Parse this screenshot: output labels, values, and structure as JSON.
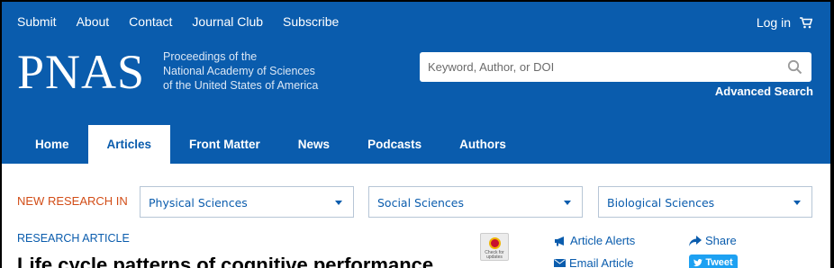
{
  "utility_nav": [
    "Submit",
    "About",
    "Contact",
    "Journal Club",
    "Subscribe"
  ],
  "login_label": "Log in",
  "logo_text": "PNAS",
  "tagline": [
    "Proceedings of the",
    "National Academy of Sciences",
    "of the United States of America"
  ],
  "search": {
    "placeholder": "Keyword, Author, or DOI",
    "advanced": "Advanced Search"
  },
  "main_tabs": [
    {
      "label": "Home",
      "active": false
    },
    {
      "label": "Articles",
      "active": true
    },
    {
      "label": "Front Matter",
      "active": false
    },
    {
      "label": "News",
      "active": false
    },
    {
      "label": "Podcasts",
      "active": false
    },
    {
      "label": "Authors",
      "active": false
    }
  ],
  "new_research": {
    "label": "NEW RESEARCH IN",
    "selects": [
      "Physical Sciences",
      "Social Sciences",
      "Biological Sciences"
    ]
  },
  "article": {
    "type": "RESEARCH ARTICLE",
    "title": "Life cycle patterns of cognitive performance",
    "badge_text": "Check for updates"
  },
  "actions": {
    "alerts": "Article Alerts",
    "email": "Email Article",
    "share": "Share",
    "tweet": "Tweet"
  },
  "colors": {
    "brand": "#0a5cad",
    "accent": "#d24d17",
    "twitter": "#1da1f2"
  }
}
